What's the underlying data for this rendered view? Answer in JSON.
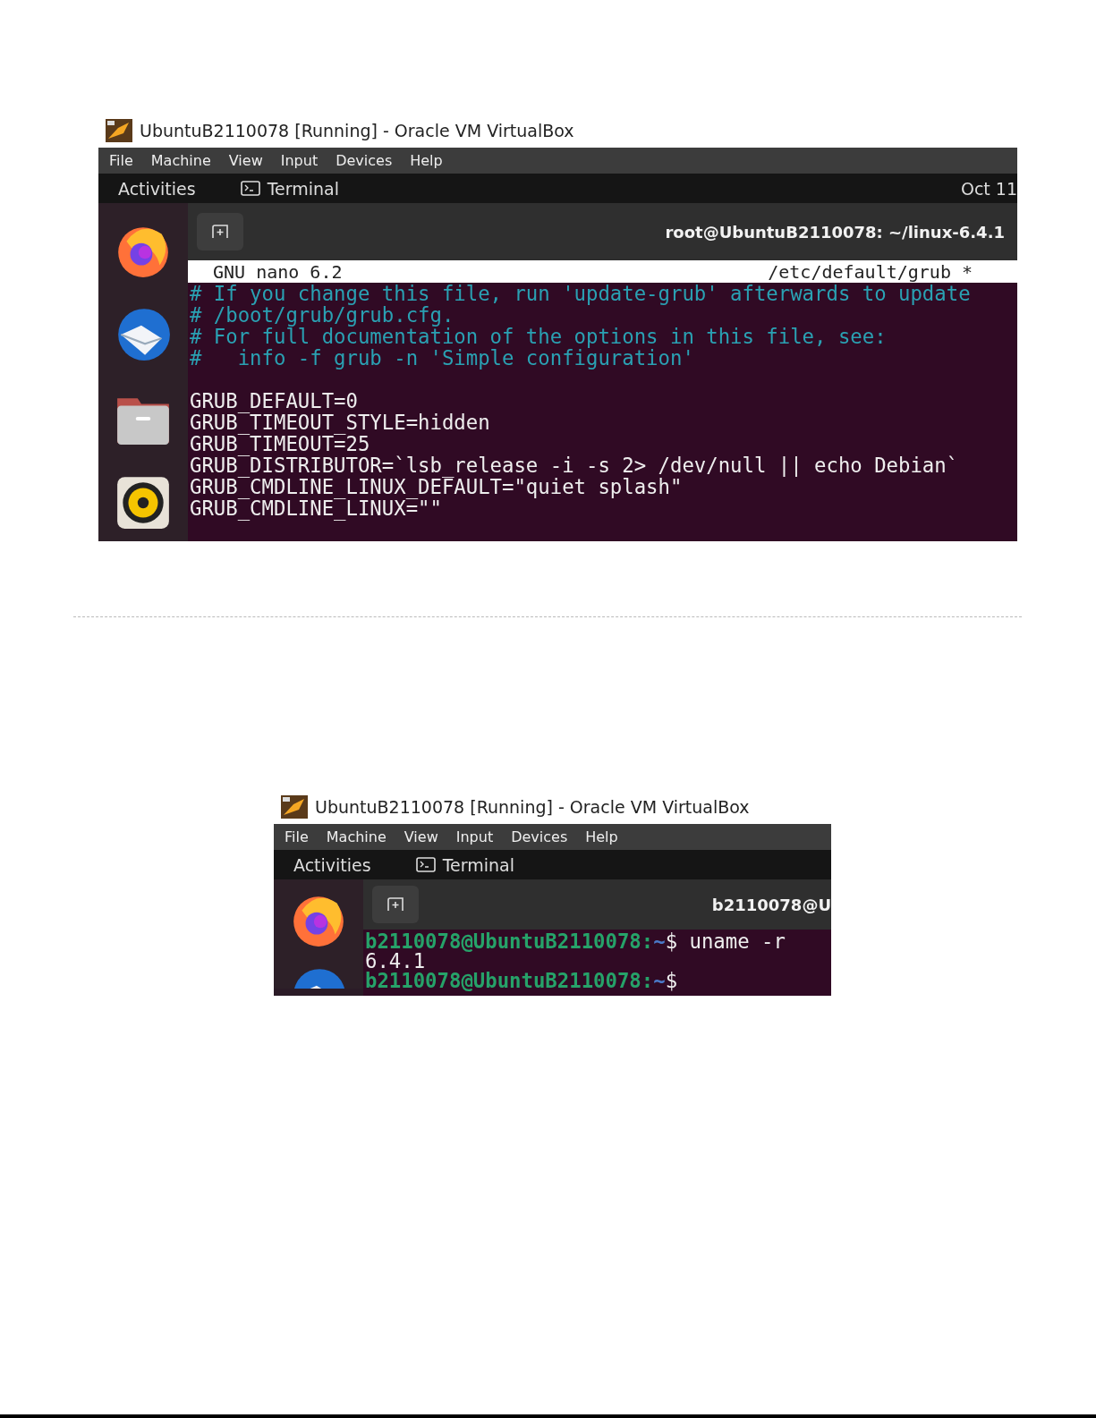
{
  "screenshots": [
    {
      "window_title": "UbuntuB2110078 [Running] - Oracle VM VirtualBox",
      "menu": [
        "File",
        "Machine",
        "View",
        "Input",
        "Devices",
        "Help"
      ],
      "activities": "Activities",
      "app_label": "Terminal",
      "clock": "Oct 11",
      "dock": [
        {
          "kind": "browser"
        },
        {
          "kind": "mail"
        },
        {
          "kind": "files"
        },
        {
          "kind": "music"
        }
      ],
      "terminal_title": "root@UbuntuB2110078: ~/linux-6.4.1",
      "nano_bar": {
        "left": "GNU nano 6.2",
        "right": "/etc/default/grub *"
      },
      "lines": [
        {
          "kind": "comment",
          "text": "# If you change this file, run 'update-grub' afterwards to update"
        },
        {
          "kind": "comment",
          "text": "# /boot/grub/grub.cfg."
        },
        {
          "kind": "comment",
          "text": "# For full documentation of the options in this file, see:"
        },
        {
          "kind": "comment",
          "text": "#   info -f grub -n 'Simple configuration'"
        },
        {
          "kind": "blank"
        },
        {
          "kind": "plain",
          "text": "GRUB_DEFAULT=0"
        },
        {
          "kind": "plain",
          "text": "GRUB_TIMEOUT_STYLE=hidden"
        },
        {
          "kind": "plain",
          "text": "GRUB_TIMEOUT=25"
        },
        {
          "kind": "plain",
          "text": "GRUB_DISTRIBUTOR=`lsb_release -i -s 2> /dev/null || echo Debian`"
        },
        {
          "kind": "plain",
          "text": "GRUB_CMDLINE_LINUX_DEFAULT=\"quiet splash\""
        },
        {
          "kind": "plain",
          "text": "GRUB_CMDLINE_LINUX=\"\""
        }
      ]
    },
    {
      "window_title": "UbuntuB2110078 [Running] - Oracle VM VirtualBox",
      "menu": [
        "File",
        "Machine",
        "View",
        "Input",
        "Devices",
        "Help"
      ],
      "activities": "Activities",
      "app_label": "Terminal",
      "dock": [
        {
          "kind": "browser"
        },
        {
          "kind": "mail"
        }
      ],
      "terminal_title": "b2110078@U",
      "lines": [
        {
          "kind": "prompt",
          "user": "b2110078@UbuntuB2110078:",
          "path": "~",
          "sign": "$",
          "command": "uname -r"
        },
        {
          "kind": "plain",
          "text": "6.4.1"
        },
        {
          "kind": "prompt",
          "user": "b2110078@UbuntuB2110078:",
          "path": "~",
          "sign": "$"
        }
      ]
    }
  ]
}
